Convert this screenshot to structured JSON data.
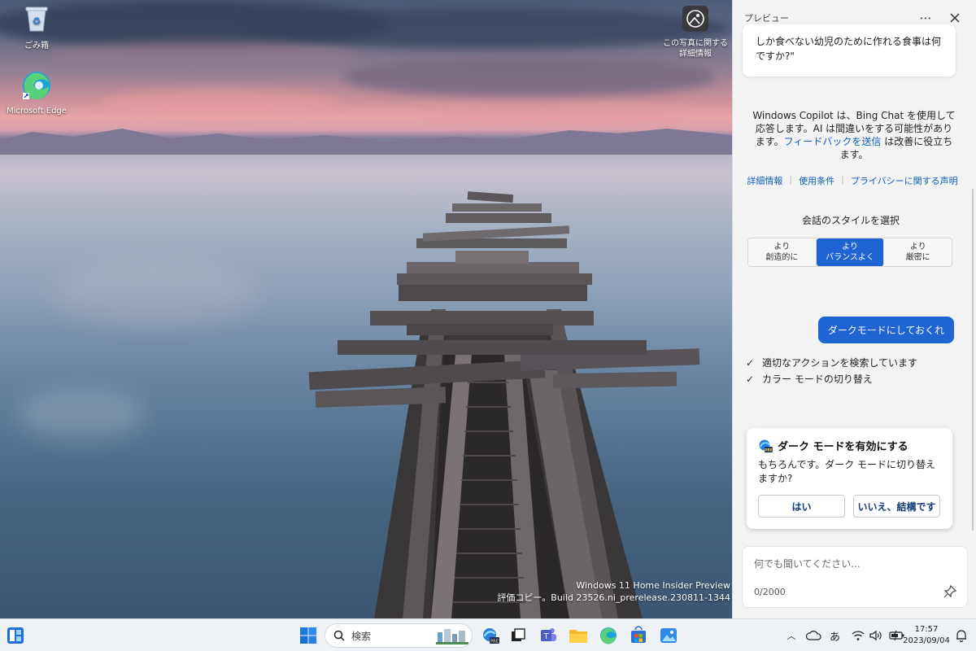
{
  "desktop": {
    "icons": [
      {
        "label": "ごみ箱",
        "icon": "recycle-bin-icon"
      },
      {
        "label": "Microsoft Edge",
        "icon": "edge-icon"
      }
    ],
    "photo_info_label": "この写真に関する詳細情報",
    "watermark": {
      "line1": "Windows 11 Home Insider Preview",
      "line2": "評価コピー。Build 23526.ni_prerelease.230811-1344"
    }
  },
  "copilot": {
    "title": "プレビュー",
    "quote_text": "しか食べない幼児のために作れる食事は何ですか?\"",
    "disclaimer_before": "Windows Copilot は、Bing Chat を使用して応答します。AI は間違いをする可能性があります。",
    "disclaimer_link": "フィードバックを送信",
    "disclaimer_after": " は改善に役立ちます。",
    "links": [
      "詳細情報",
      "使用条件",
      "プライバシーに関する声明"
    ],
    "style_title": "会話のスタイルを選択",
    "styles": [
      {
        "line1": "より",
        "line2": "創造的に",
        "active": false
      },
      {
        "line1": "より",
        "line2": "バランスよく",
        "active": true
      },
      {
        "line1": "より",
        "line2": "厳密に",
        "active": false
      }
    ],
    "user_message": "ダークモードにしておくれ",
    "status_items": [
      "適切なアクションを検索しています",
      "カラー モードの切り替え"
    ],
    "action_card": {
      "title": "ダーク モードを有効にする",
      "body": "もちろんです。ダーク モードに切り替えますか?",
      "yes_label": "はい",
      "no_label": "いいえ、結構です"
    },
    "input_placeholder": "何でも聞いてください...",
    "char_counter": "0/2000"
  },
  "taskbar": {
    "search_label": "検索",
    "ime_label": "あ",
    "time": "17:57",
    "date": "2023/09/04"
  },
  "colors": {
    "accent": "#1f64d3",
    "link": "#0f5fbd"
  }
}
